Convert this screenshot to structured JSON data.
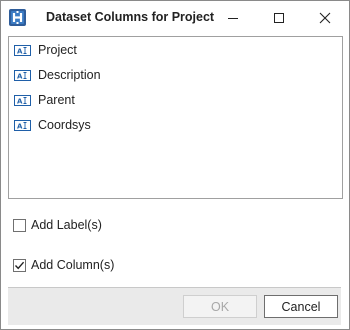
{
  "window": {
    "title": "Dataset Columns for Project",
    "icon": "app-logo-icon",
    "accent_color": "#1f5fa8"
  },
  "titlebar_buttons": [
    {
      "name": "minimize",
      "icon": "minimize-icon"
    },
    {
      "name": "maximize",
      "icon": "maximize-icon"
    },
    {
      "name": "close",
      "icon": "close-icon"
    }
  ],
  "columns": [
    {
      "label": "Project",
      "icon": "text-field-icon"
    },
    {
      "label": "Description",
      "icon": "text-field-icon"
    },
    {
      "label": "Parent",
      "icon": "text-field-icon"
    },
    {
      "label": "Coordsys",
      "icon": "text-field-icon"
    }
  ],
  "options": {
    "add_labels": {
      "label": "Add Label(s)",
      "checked": false
    },
    "add_columns": {
      "label": "Add Column(s)",
      "checked": true
    }
  },
  "buttons": {
    "ok": {
      "label": "OK",
      "enabled": false
    },
    "cancel": {
      "label": "Cancel",
      "enabled": true
    }
  }
}
